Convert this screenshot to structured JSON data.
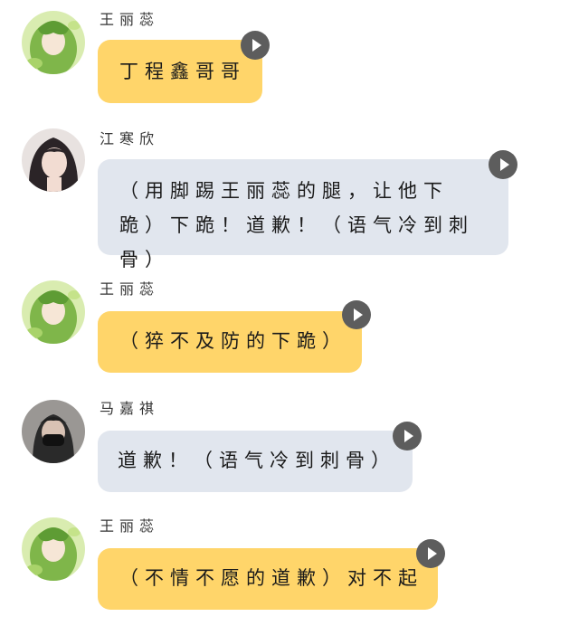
{
  "messages": [
    {
      "speaker": "王丽蕊",
      "avatar": "green-anime-girl-avatar",
      "bubble_color": "yellow",
      "text": "丁程鑫哥哥"
    },
    {
      "speaker": "江寒欣",
      "avatar": "dark-hair-girl-avatar",
      "bubble_color": "grey",
      "text": "（用脚踢王丽蕊的腿，让他下跪）下跪！道歉！（语气冷到刺骨）"
    },
    {
      "speaker": "王丽蕊",
      "avatar": "green-anime-girl-avatar",
      "bubble_color": "yellow",
      "text": "（猝不及防的下跪）"
    },
    {
      "speaker": "马嘉祺",
      "avatar": "masked-boy-avatar",
      "bubble_color": "grey",
      "text": "道歉！（语气冷到刺骨）"
    },
    {
      "speaker": "王丽蕊",
      "avatar": "green-anime-girl-avatar",
      "bubble_color": "yellow",
      "text": "（不情不愿的道歉）对不起"
    }
  ],
  "colors": {
    "yellow_bubble": "#ffd56a",
    "grey_bubble": "#e1e6ee",
    "play_button": "#5d5d5d"
  },
  "icons": {
    "play": "play-icon"
  }
}
